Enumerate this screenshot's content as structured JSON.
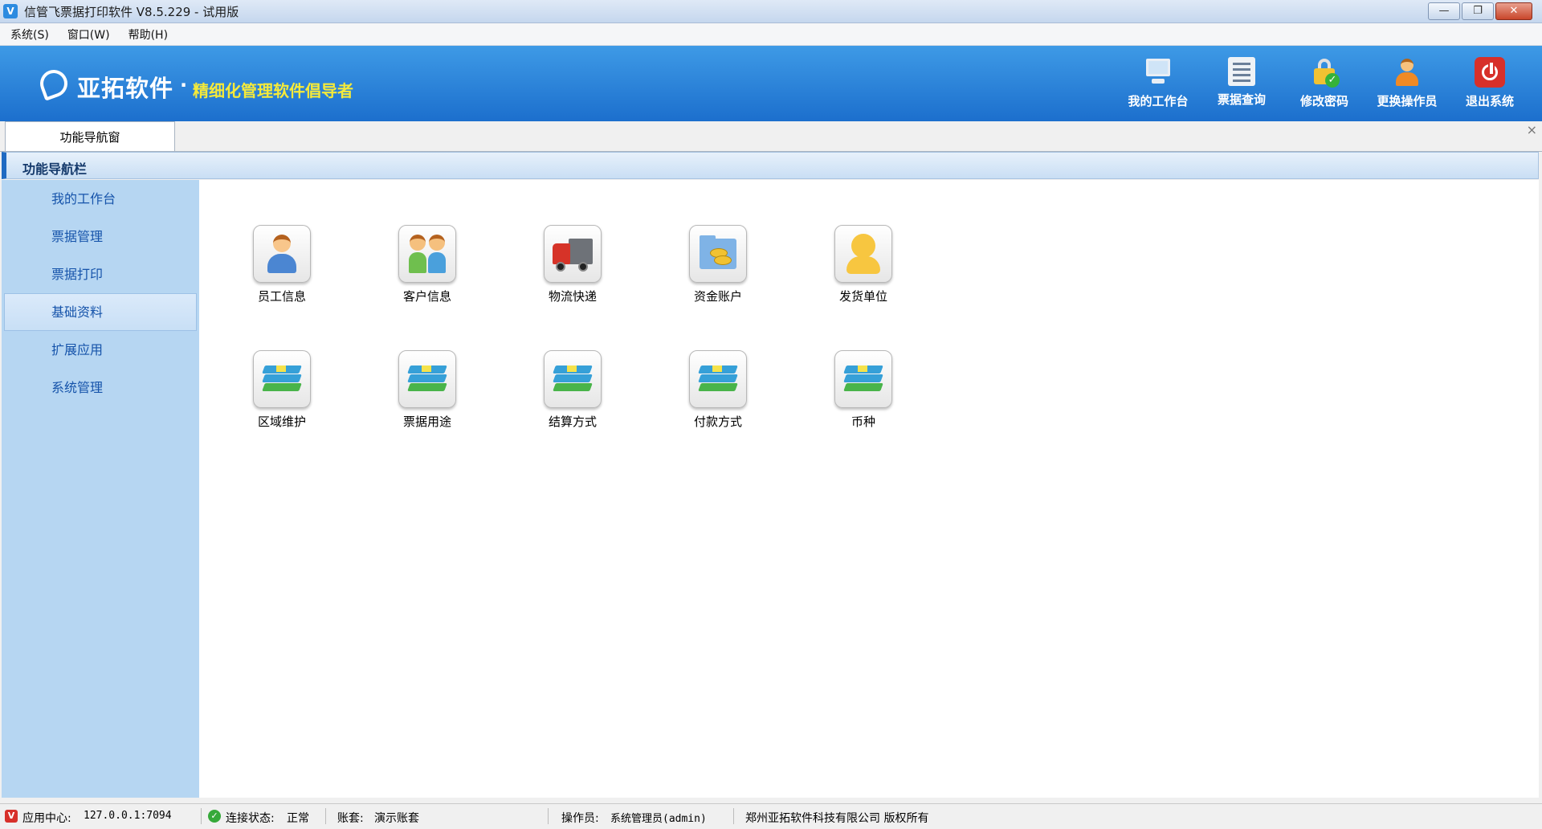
{
  "window": {
    "title": "信管飞票据打印软件 V8.5.229 - 试用版",
    "app_icon": "app-logo-icon",
    "controls": {
      "minimize": "—",
      "restore": "❐",
      "close": "✕"
    }
  },
  "menu": [
    {
      "label": "系统(S)"
    },
    {
      "label": "窗口(W)"
    },
    {
      "label": "帮助(H)"
    }
  ],
  "banner": {
    "logo_text": "亚拓软件",
    "logo_dot": "·",
    "slogan": "精细化管理软件倡导者",
    "toolbar": [
      {
        "label": "我的工作台",
        "icon": "monitor-icon"
      },
      {
        "label": "票据查询",
        "icon": "list-icon"
      },
      {
        "label": "修改密码",
        "icon": "lock-icon"
      },
      {
        "label": "更换操作员",
        "icon": "person-icon"
      },
      {
        "label": "退出系统",
        "icon": "power-icon"
      }
    ]
  },
  "tabs": [
    {
      "label": "功能导航窗",
      "active": true
    }
  ],
  "tab_close": "×",
  "nav_header": "功能导航栏",
  "sidebar": {
    "items": [
      {
        "label": "我的工作台"
      },
      {
        "label": "票据管理"
      },
      {
        "label": "票据打印"
      },
      {
        "label": "基础资料",
        "active": true
      },
      {
        "label": "扩展应用"
      },
      {
        "label": "系统管理"
      }
    ]
  },
  "content": {
    "items": [
      {
        "label": "员工信息",
        "icon": "employee-icon"
      },
      {
        "label": "客户信息",
        "icon": "customers-icon"
      },
      {
        "label": "物流快递",
        "icon": "truck-icon"
      },
      {
        "label": "资金账户",
        "icon": "fund-folder-icon"
      },
      {
        "label": "发货单位",
        "icon": "shipper-icon"
      },
      {
        "label": "区域维护",
        "icon": "books-icon"
      },
      {
        "label": "票据用途",
        "icon": "books-icon"
      },
      {
        "label": "结算方式",
        "icon": "books-icon"
      },
      {
        "label": "付款方式",
        "icon": "books-icon"
      },
      {
        "label": "币种",
        "icon": "books-icon"
      }
    ]
  },
  "statusbar": {
    "app_center_label": "应用中心:",
    "app_center_value": "127.0.0.1:7094",
    "connection_label": "连接状态:",
    "connection_value": "正常",
    "account_label": "账套:",
    "account_value": "演示账套",
    "operator_label": "操作员:",
    "operator_value": "系统管理员(admin)",
    "copyright": "郑州亚拓软件科技有限公司 版权所有"
  },
  "colors": {
    "banner_top": "#3e9ae6",
    "banner_bottom": "#1c6fcd",
    "slogan": "#f5ea3a",
    "sidebar_bg": "#b6d6f2",
    "sidebar_text": "#1553aa"
  }
}
